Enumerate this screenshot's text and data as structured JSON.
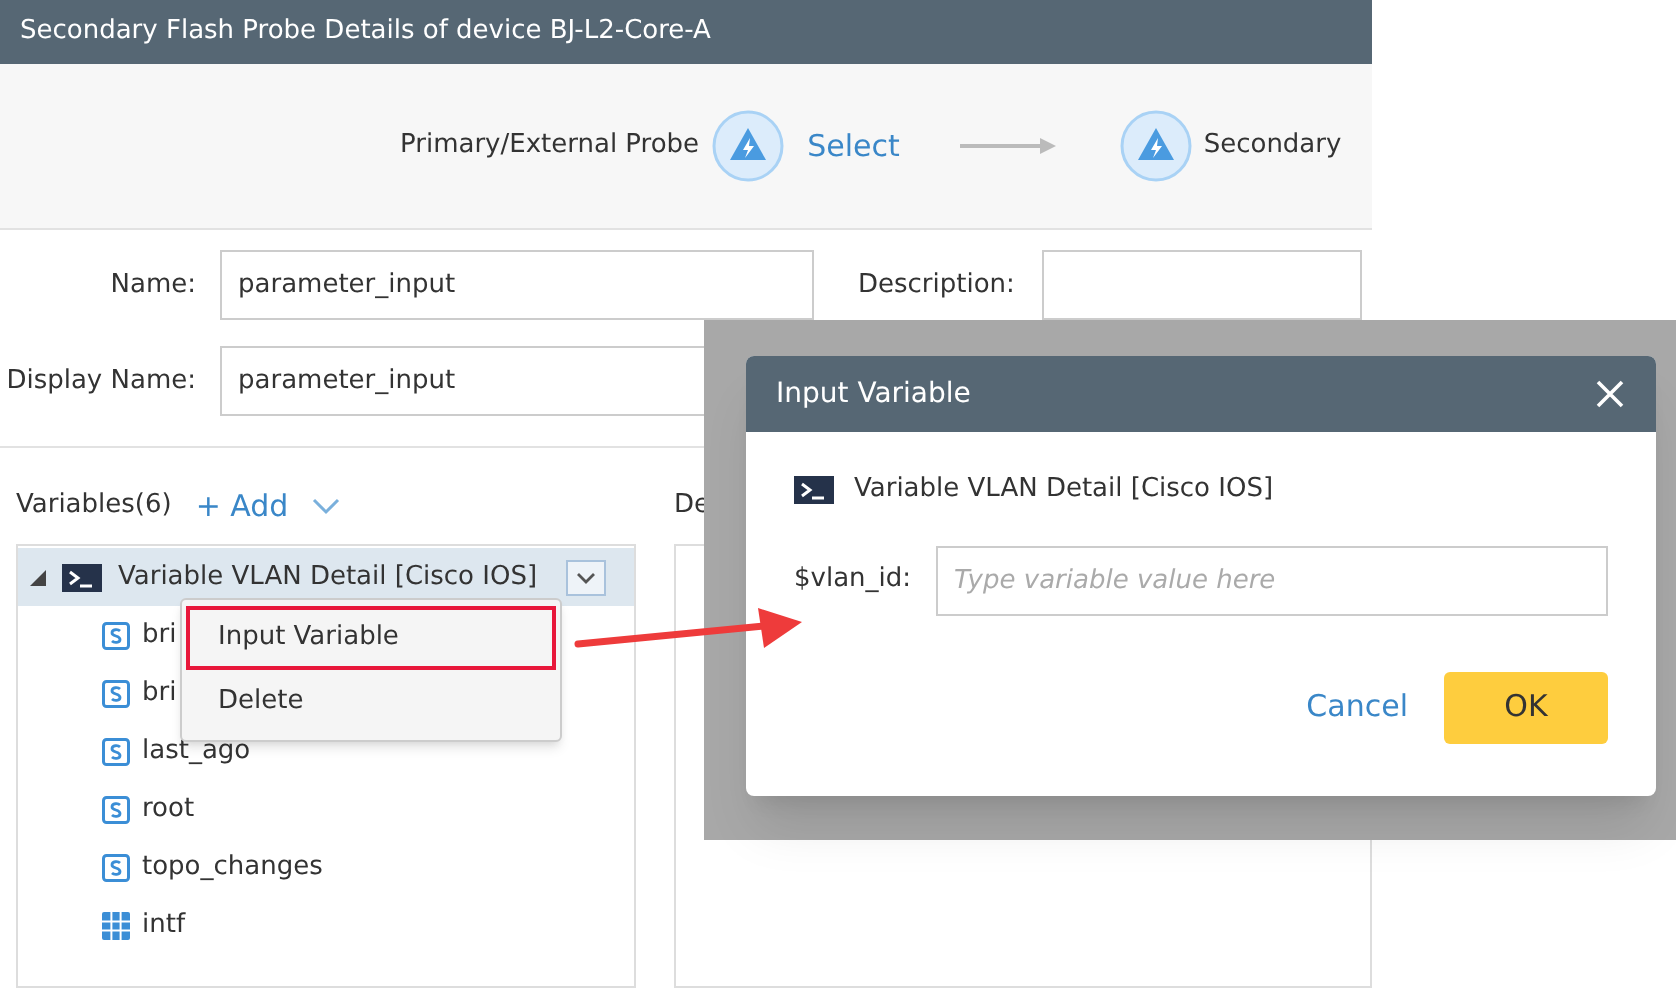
{
  "window": {
    "title": "Secondary Flash Probe Details of device BJ-L2-Core-A"
  },
  "wizard": {
    "steps": [
      {
        "label": "Primary/External Probe",
        "link": "Select"
      },
      {
        "label": "Secondary"
      }
    ]
  },
  "form": {
    "fields": [
      {
        "label": "Name:",
        "value": "parameter_input"
      },
      {
        "label": "Description:"
      },
      {
        "label": "Display Name:",
        "value": "parameter_input"
      }
    ]
  },
  "variables": {
    "title": "Variables(6)",
    "add": "+ Add",
    "tree": [
      {
        "label": "Variable VLAN Detail [Cisco IOS]",
        "kind": "script",
        "expanded": true,
        "selected": true,
        "children": [
          {
            "label": "bri",
            "kind": "string",
            "selected": false
          },
          {
            "label": "bri",
            "kind": "string",
            "selected": false
          },
          {
            "label": "last_ago",
            "kind": "string",
            "selected": false
          },
          {
            "label": "root",
            "kind": "string",
            "selected": false
          },
          {
            "label": "topo_changes",
            "kind": "string",
            "selected": false
          },
          {
            "label": "intf",
            "kind": "table",
            "selected": false
          }
        ]
      }
    ]
  },
  "details_panel": {
    "title": "De"
  },
  "context_menu": {
    "items": [
      {
        "label": "Input Variable",
        "highlighted": true
      },
      {
        "label": "Delete",
        "highlighted": false
      }
    ]
  },
  "dialog": {
    "title": "Input Variable",
    "source": "Variable VLAN Detail [Cisco IOS]",
    "field": {
      "label": "$vlan_id:",
      "placeholder": "Type variable value here"
    },
    "buttons": [
      {
        "label": "Cancel",
        "kind": "link"
      },
      {
        "label": "OK",
        "kind": "primary"
      }
    ]
  }
}
